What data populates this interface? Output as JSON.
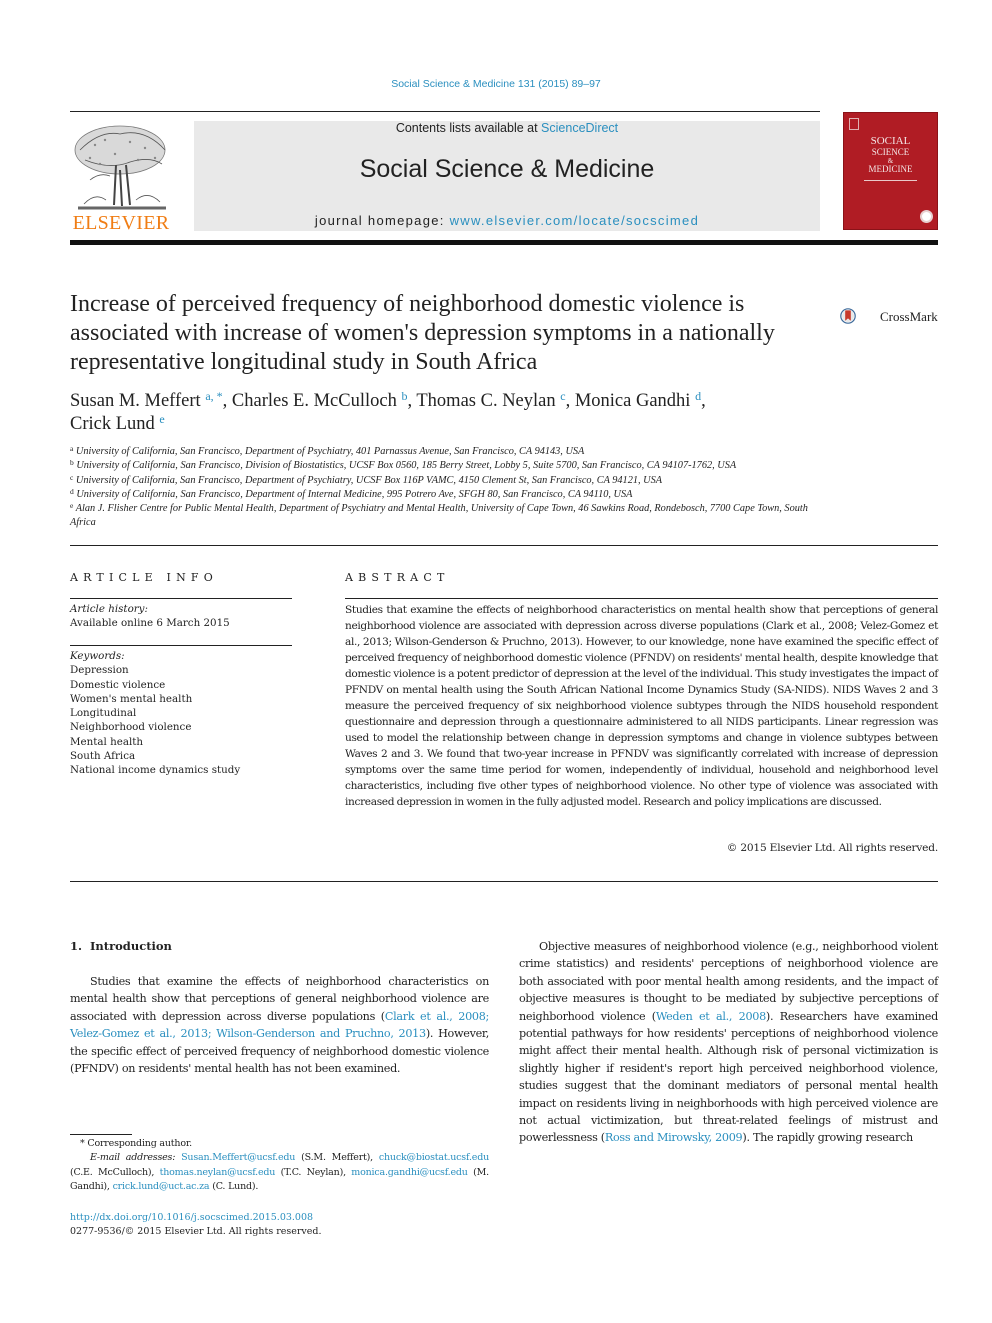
{
  "running_head": "Social Science & Medicine 131 (2015) 89–97",
  "masthead": {
    "publisher": "ELSEVIER",
    "contents_prefix": "Contents lists available at ",
    "contents_link": "ScienceDirect",
    "journal_title": "Social Science & Medicine",
    "homepage_prefix": "journal homepage: ",
    "homepage_link": "www.elsevier.com/locate/socscimed",
    "cover": {
      "line1": "SOCIAL",
      "line2": "SCIENCE",
      "line3": "&",
      "line4": "MEDICINE",
      "color": "#b01c24"
    }
  },
  "article": {
    "title": "Increase of perceived frequency of neighborhood domestic violence is associated with increase of women's depression symptoms in a nationally representative longitudinal study in South Africa",
    "crossmark_label": "CrossMark",
    "authors": [
      {
        "name": "Susan M. Meffert",
        "sup": "a, *",
        "sep": ", "
      },
      {
        "name": "Charles E. McCulloch",
        "sup": "b",
        "sep": ", "
      },
      {
        "name": "Thomas C. Neylan",
        "sup": "c",
        "sep": ", "
      },
      {
        "name": "Monica Gandhi",
        "sup": "d",
        "sep": ","
      },
      {
        "name": "Crick Lund",
        "sup": "e",
        "sep": ""
      }
    ],
    "affiliations": [
      {
        "key": "a",
        "text": "University of California, San Francisco, Department of Psychiatry, 401 Parnassus Avenue, San Francisco, CA 94143, USA"
      },
      {
        "key": "b",
        "text": "University of California, San Francisco, Division of Biostatistics, UCSF Box 0560, 185 Berry Street, Lobby 5, Suite 5700, San Francisco, CA 94107-1762, USA"
      },
      {
        "key": "c",
        "text": "University of California, San Francisco, Department of Psychiatry, UCSF Box 116P VAMC, 4150 Clement St, San Francisco, CA 94121, USA"
      },
      {
        "key": "d",
        "text": "University of California, San Francisco, Department of Internal Medicine, 995 Potrero Ave, SFGH 80, San Francisco, CA 94110, USA"
      },
      {
        "key": "e",
        "text": "Alan J. Flisher Centre for Public Mental Health, Department of Psychiatry and Mental Health, University of Cape Town, 46 Sawkins Road, Rondebosch, 7700 Cape Town, South Africa"
      }
    ]
  },
  "article_info": {
    "heading": "ARTICLE INFO",
    "history_label": "Article history:",
    "history_value": "Available online 6 March 2015",
    "keywords_label": "Keywords:",
    "keywords": [
      "Depression",
      "Domestic violence",
      "Women's mental health",
      "Longitudinal",
      "Neighborhood violence",
      "Mental health",
      "South Africa",
      "National income dynamics study"
    ]
  },
  "abstract": {
    "heading": "ABSTRACT",
    "text": "Studies that examine the effects of neighborhood characteristics on mental health show that perceptions of general neighborhood violence are associated with depression across diverse populations (Clark et al., 2008; Velez-Gomez et al., 2013; Wilson-Genderson & Pruchno, 2013). However, to our knowledge, none have examined the specific effect of perceived frequency of neighborhood domestic violence (PFNDV) on residents' mental health, despite knowledge that domestic violence is a potent predictor of depression at the level of the individual. This study investigates the impact of PFNDV on mental health using the South African National Income Dynamics Study (SA-NIDS). NIDS Waves 2 and 3 measure the perceived frequency of six neighborhood violence subtypes through the NIDS household respondent questionnaire and depression through a questionnaire administered to all NIDS participants. Linear regression was used to model the relationship between change in depression symptoms and change in violence subtypes between Waves 2 and 3. We found that two-year increase in PFNDV was significantly correlated with increase of depression symptoms over the same time period for women, independently of individual, household and neighborhood level characteristics, including five other types of neighborhood violence. No other type of violence was associated with increased depression in women in the fully adjusted model. Research and policy implications are discussed.",
    "copyright": "© 2015 Elsevier Ltd. All rights reserved."
  },
  "body": {
    "intro_heading": "1.  Introduction",
    "p1_before": "Studies that examine the effects of neighborhood characteristics on mental health show that perceptions of general neighborhood violence are associated with depression across diverse populations (",
    "p1_cite": "Clark et al., 2008; Velez-Gomez et al., 2013; Wilson-Genderson and Pruchno, 2013",
    "p1_after": "). However, the specific effect of perceived frequency of neighborhood domestic violence (PFNDV) on residents' mental health has not been examined.",
    "p2_before": "Objective measures of neighborhood violence (e.g., neighborhood violent crime statistics) and residents' perceptions of neighborhood violence are both associated with poor mental health among residents, and the impact of objective measures is thought to be mediated by subjective perceptions of neighborhood violence (",
    "p2_cite1": "Weden et al., 2008",
    "p2_middle": "). Researchers have examined potential pathways for how residents' perceptions of neighborhood violence might affect their mental health. Although risk of personal victimization is slightly higher if resident's report high perceived neighborhood violence, studies suggest that the dominant mediators of personal mental health impact on residents living in neighborhoods with high perceived violence are not actual victimization, but threat-related feelings of mistrust and powerlessness (",
    "p2_cite2": "Ross and Mirowsky, 2009",
    "p2_after": "). The rapidly growing research"
  },
  "footnotes": {
    "corresponding": "* Corresponding author.",
    "email_label": "E-mail addresses:",
    "emails": [
      {
        "email": "Susan.Meffert@ucsf.edu",
        "who": " (S.M. Meffert), "
      },
      {
        "email": "chuck@biostat.ucsf.edu",
        "who": " (C.E. McCulloch), "
      },
      {
        "email": "thomas.neylan@ucsf.edu",
        "who": " (T.C. Neylan), "
      },
      {
        "email": "monica.gandhi@ucsf.edu",
        "who": " (M. Gandhi), "
      },
      {
        "email": "crick.lund@uct.ac.za",
        "who": " (C. Lund)."
      }
    ],
    "doi": "http://dx.doi.org/10.1016/j.socscimed.2015.03.008",
    "issn": "0277-9536/© 2015 Elsevier Ltd. All rights reserved."
  }
}
